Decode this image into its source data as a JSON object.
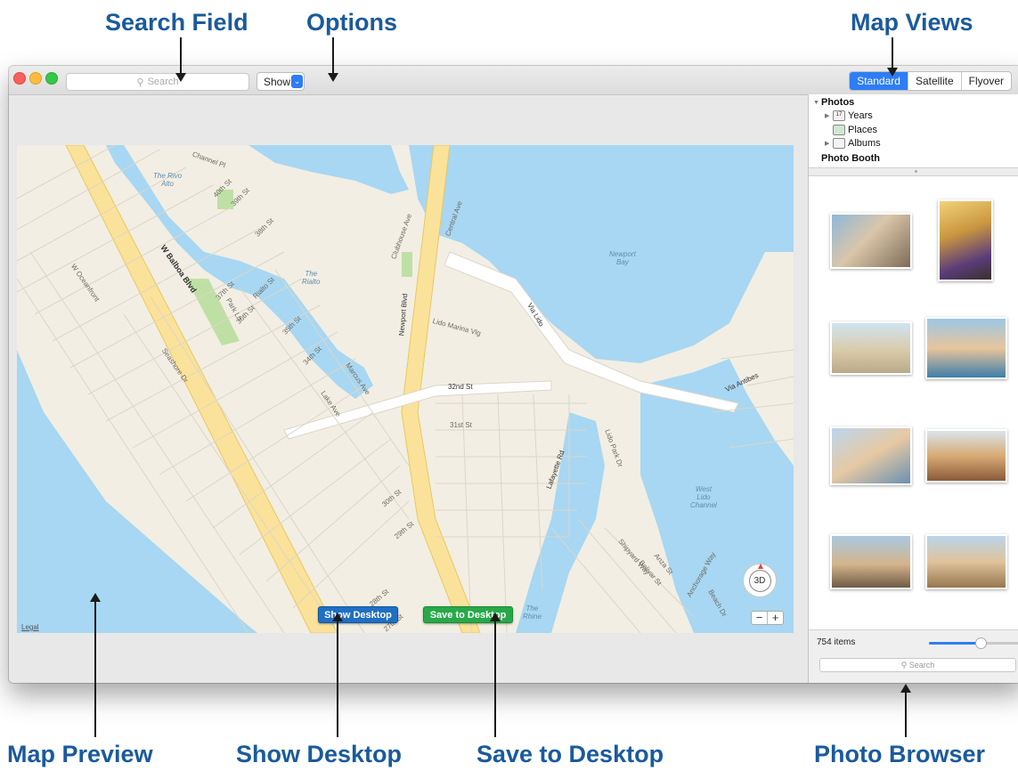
{
  "callouts": {
    "search_field": "Search Field",
    "options": "Options",
    "map_views": "Map Views",
    "map_preview": "Map Preview",
    "show_desktop": "Show Desktop",
    "save_to_desktop": "Save to Desktop",
    "photo_browser": "Photo Browser"
  },
  "toolbar": {
    "search_placeholder": "Search",
    "show_label": "Show",
    "view_modes": [
      "Standard",
      "Satellite",
      "Flyover"
    ],
    "active_view": "Standard"
  },
  "map": {
    "legal": "Legal",
    "compass_label": "3D",
    "zoom_out": "−",
    "zoom_in": "+",
    "show_desktop_button": "Show Desktop",
    "save_desktop_button": "Save to Desktop",
    "street_labels": [
      "Channel Pl",
      "40th St",
      "39th St",
      "38th St",
      "37th St",
      "36th St",
      "35th St",
      "34th St",
      "Rialto St",
      "Park Ln",
      "W Balboa Blvd",
      "W Oceanfront",
      "Seashore Dr",
      "Marcus Ave",
      "Lake Ave",
      "Clubhouse Ave",
      "Central Ave",
      "Newport Blvd",
      "Lido Marina Vlg",
      "Via Lido",
      "32nd St",
      "31st St",
      "30th St",
      "29th St",
      "28th St",
      "27th St",
      "Lafayette Rd",
      "Lido Park Dr",
      "Via Antibes",
      "Shipyard Way",
      "Anza St",
      "Bolivar St",
      "Anchorage Way",
      "Beach Dr"
    ],
    "water_labels": {
      "rivo_alto": "The Rivo\nAlto",
      "rialto": "The\nRialto",
      "newport_bay": "Newport\nBay",
      "west_lido": "West\nLido\nChannel",
      "rhine": "The\nRhine"
    }
  },
  "sidebar": {
    "photos": "Photos",
    "years": "Years",
    "places": "Places",
    "albums": "Albums",
    "photo_booth": "Photo Booth",
    "item_count": "754 items",
    "thumbnail_size": 0.55,
    "search_placeholder": "Search"
  },
  "colors": {
    "accent": "#2e7df6",
    "callout": "#1a5a9c",
    "show_button": "#1f6fc5",
    "save_button": "#27a948",
    "water": "#a7d7f2",
    "land": "#f2eee3",
    "highway": "#fbe29a"
  }
}
